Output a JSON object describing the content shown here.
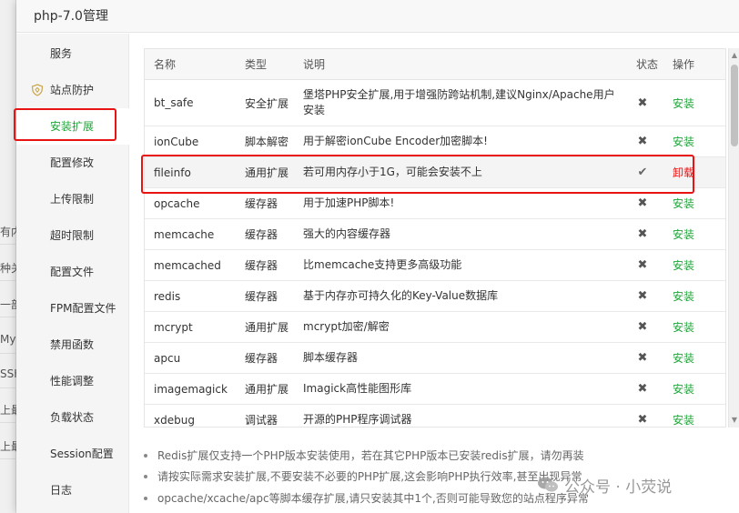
{
  "background": {
    "fragments": [
      "有内",
      "种关",
      "一部",
      "MyS",
      "SSH",
      "上最",
      "上最"
    ]
  },
  "dialog": {
    "title": "php-7.0管理"
  },
  "sidebar": {
    "items": [
      {
        "label": "服务"
      },
      {
        "label": "站点防护",
        "icon": "shield-icon"
      },
      {
        "label": "安装扩展",
        "active": true
      },
      {
        "label": "配置修改"
      },
      {
        "label": "上传限制"
      },
      {
        "label": "超时限制"
      },
      {
        "label": "配置文件"
      },
      {
        "label": "FPM配置文件"
      },
      {
        "label": "禁用函数"
      },
      {
        "label": "性能调整"
      },
      {
        "label": "负载状态"
      },
      {
        "label": "Session配置"
      },
      {
        "label": "日志"
      }
    ]
  },
  "table": {
    "headers": {
      "name": "名称",
      "type": "类型",
      "desc": "说明",
      "status": "状态",
      "action": "操作"
    },
    "rows": [
      {
        "name": "bt_safe",
        "type": "安全扩展",
        "desc": "堡塔PHP安全扩展,用于增强防跨站机制,建议Nginx/Apache用户安装",
        "status": "✖",
        "action": "安装"
      },
      {
        "name": "ionCube",
        "type": "脚本解密",
        "desc": "用于解密ionCube Encoder加密脚本!",
        "status": "✖",
        "action": "安装"
      },
      {
        "name": "fileinfo",
        "type": "通用扩展",
        "desc": "若可用内存小于1G，可能会安装不上",
        "status": "✔",
        "action": "卸载"
      },
      {
        "name": "opcache",
        "type": "缓存器",
        "desc": "用于加速PHP脚本!",
        "status": "✖",
        "action": "安装"
      },
      {
        "name": "memcache",
        "type": "缓存器",
        "desc": "强大的内容缓存器",
        "status": "✖",
        "action": "安装"
      },
      {
        "name": "memcached",
        "type": "缓存器",
        "desc": "比memcache支持更多高级功能",
        "status": "✖",
        "action": "安装"
      },
      {
        "name": "redis",
        "type": "缓存器",
        "desc": "基于内存亦可持久化的Key-Value数据库",
        "status": "✖",
        "action": "安装"
      },
      {
        "name": "mcrypt",
        "type": "通用扩展",
        "desc": "mcrypt加密/解密",
        "status": "✖",
        "action": "安装"
      },
      {
        "name": "apcu",
        "type": "缓存器",
        "desc": "脚本缓存器",
        "status": "✖",
        "action": "安装"
      },
      {
        "name": "imagemagick",
        "type": "通用扩展",
        "desc": "Imagick高性能图形库",
        "status": "✖",
        "action": "安装"
      },
      {
        "name": "xdebug",
        "type": "调试器",
        "desc": "开源的PHP程序调试器",
        "status": "✖",
        "action": "安装"
      }
    ]
  },
  "notes": [
    "Redis扩展仅支持一个PHP版本安装使用，若在其它PHP版本已安装redis扩展，请勿再装",
    "请按实际需求安装扩展,不要安装不必要的PHP扩展,这会影响PHP执行效率,甚至出现异常",
    "opcache/xcache/apc等脚本缓存扩展,请只安装其中1个,否则可能导致您的站点程序异常"
  ],
  "watermark": {
    "text": "公众号 · 小荧说",
    "icon": "wechat-icon"
  },
  "colors": {
    "accent_green": "#20a53a",
    "danger_red": "#e81313"
  }
}
